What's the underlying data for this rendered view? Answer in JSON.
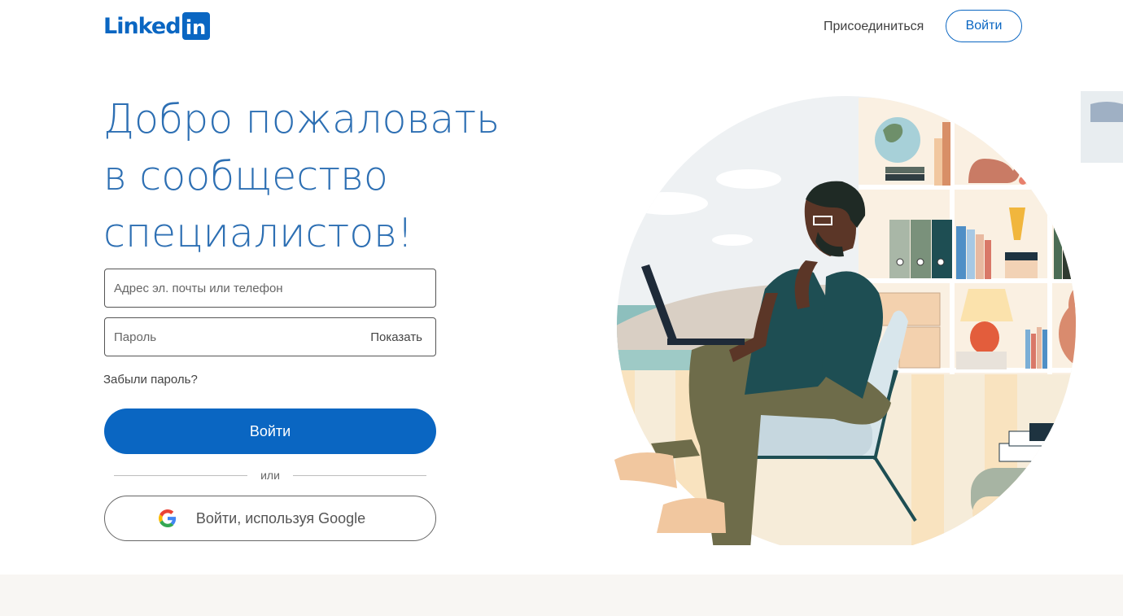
{
  "header": {
    "logo_text": "Linked",
    "logo_box_text": "in",
    "join_label": "Присоединиться",
    "signin_label": "Войти"
  },
  "main": {
    "headline": "Добро пожаловать в сообщество специалистов!"
  },
  "form": {
    "email_placeholder": "Адрес эл. почты или телефон",
    "email_value": "",
    "password_placeholder": "Пароль",
    "password_value": "",
    "show_label": "Показать",
    "forgot_label": "Забыли пароль?",
    "signin_label": "Войти",
    "or_label": "или",
    "google_label": "Войти, используя Google"
  },
  "colors": {
    "brand": "#0a66c2",
    "headline": "#2d6fb3",
    "footer_band": "#f8f6f3"
  }
}
